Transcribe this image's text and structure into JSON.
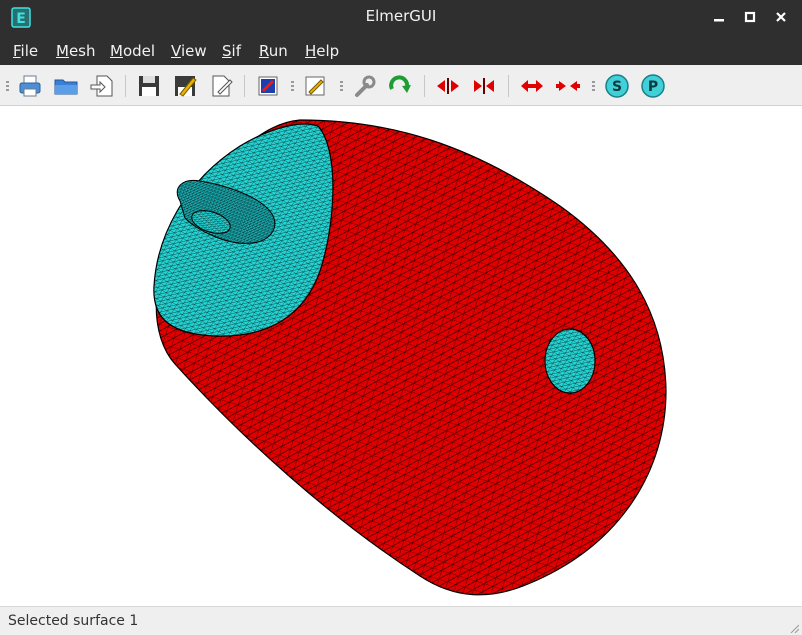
{
  "window": {
    "title": "ElmerGUI",
    "app_icon_letter": "E",
    "controls": [
      "minimize",
      "maximize",
      "close"
    ]
  },
  "menu": {
    "items": [
      {
        "label": "File",
        "mnemonic": "F",
        "rest": "ile"
      },
      {
        "label": "Mesh",
        "mnemonic": "M",
        "rest": "esh"
      },
      {
        "label": "Model",
        "mnemonic": "M",
        "rest": "odel"
      },
      {
        "label": "View",
        "mnemonic": "V",
        "rest": "iew"
      },
      {
        "label": "Sif",
        "mnemonic": "S",
        "rest": "if"
      },
      {
        "label": "Run",
        "mnemonic": "R",
        "rest": "un"
      },
      {
        "label": "Help",
        "mnemonic": "H",
        "rest": "elp"
      }
    ]
  },
  "toolbar": {
    "buttons": [
      {
        "icon": "print-icon"
      },
      {
        "icon": "open-folder-icon"
      },
      {
        "icon": "import-icon"
      },
      {
        "icon": "save-icon"
      },
      {
        "icon": "save-as-icon"
      },
      {
        "icon": "edit-document-icon"
      },
      {
        "icon": "model-icon"
      },
      {
        "icon": "edit-sif-icon"
      },
      {
        "icon": "wrench-icon"
      },
      {
        "icon": "refresh-icon"
      },
      {
        "icon": "unify-surface-icon"
      },
      {
        "icon": "divide-surface-icon"
      },
      {
        "icon": "unify-edge-icon"
      },
      {
        "icon": "divide-edge-icon"
      },
      {
        "icon": "start-solver-icon",
        "label": "S"
      },
      {
        "icon": "postprocessor-icon",
        "label": "P"
      }
    ]
  },
  "viewport": {
    "body_color": "#e00000",
    "selected_color": "#25d3d3",
    "mesh_line_color": "#000000"
  },
  "status": {
    "text": "Selected surface 1"
  }
}
